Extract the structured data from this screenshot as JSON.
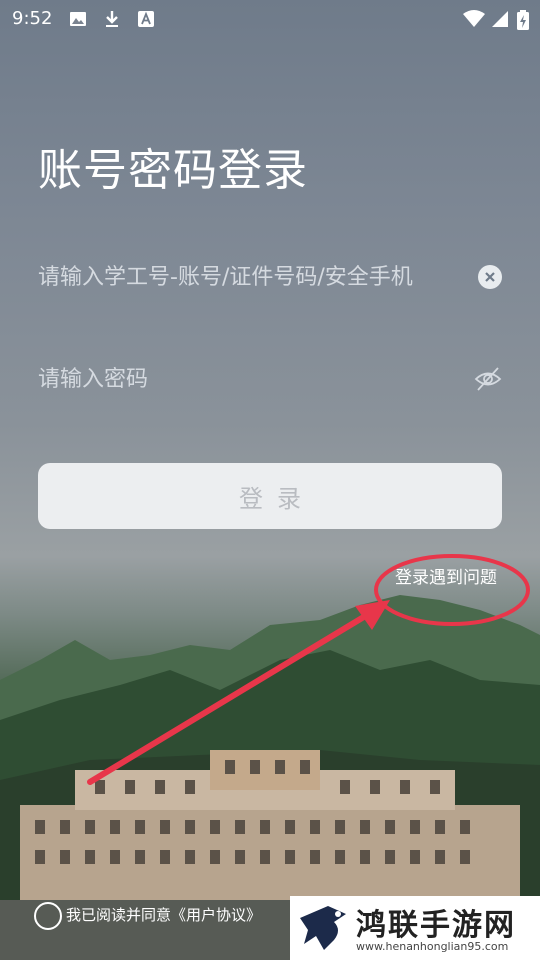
{
  "status": {
    "time": "9:52"
  },
  "login": {
    "title": "账号密码登录",
    "account_placeholder": "请输入学工号-账号/证件号码/安全手机",
    "password_placeholder": "请输入密码",
    "login_label": "登录",
    "trouble_link": "登录遇到问题",
    "agreement_text": "我已阅读并同意《用户协议》"
  },
  "watermark": {
    "title": "鸿联手游网",
    "url": "www.henanhonglian95.com"
  },
  "icons": {
    "clear": "clear-icon",
    "eye": "eye-off-icon",
    "image": "image-icon",
    "download": "download-icon",
    "font": "font-icon",
    "wifi": "wifi-icon",
    "signal": "signal-icon",
    "battery": "battery-icon"
  },
  "colors": {
    "annotation": "#e8364a"
  }
}
